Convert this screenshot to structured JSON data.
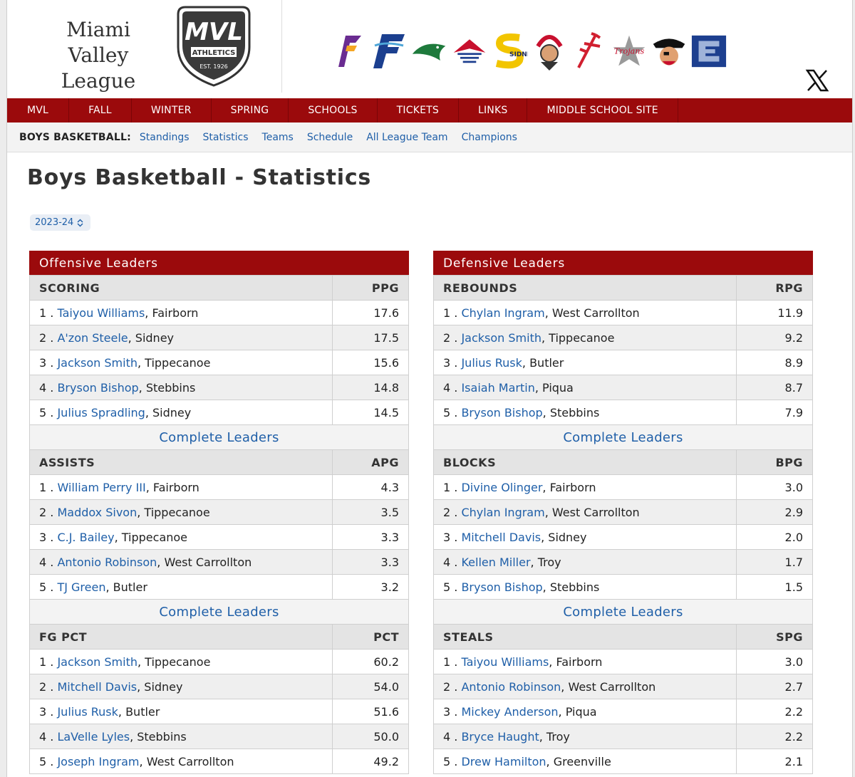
{
  "brand": {
    "line1": "Miami Valley",
    "line2": "League",
    "shield_text": "MVL",
    "shield_sub": "ATHLETICS",
    "shield_est": "EST. 1926"
  },
  "logos": [
    "fairborn-icon",
    "f-logo-icon",
    "greenville-icon",
    "butler-icon",
    "sidney-icon",
    "piqua-icon",
    "tippecanoe-icon",
    "trojans-icon",
    "pirate-icon",
    "e-logo-icon"
  ],
  "nav": [
    "MVL",
    "FALL",
    "WINTER",
    "SPRING",
    "SCHOOLS",
    "TICKETS",
    "LINKS",
    "MIDDLE SCHOOL SITE"
  ],
  "subnav": {
    "label": "BOYS BASKETBALL:",
    "links": [
      "Standings",
      "Statistics",
      "Teams",
      "Schedule",
      "All League Team",
      "Champions"
    ]
  },
  "page_title": "Boys Basketball - Statistics",
  "season": "2023-24",
  "more_label": "Complete Leaders",
  "offense": {
    "title": "Offensive Leaders",
    "sections": [
      {
        "name": "SCORING",
        "stat": "PPG",
        "rows": [
          {
            "rank": "1 .",
            "player": "Taiyou Williams",
            "team": ", Fairborn",
            "value": "17.6"
          },
          {
            "rank": "2 .",
            "player": "A'zon Steele",
            "team": ", Sidney",
            "value": "17.5"
          },
          {
            "rank": "3 .",
            "player": "Jackson Smith",
            "team": ", Tippecanoe",
            "value": "15.6"
          },
          {
            "rank": "4 .",
            "player": "Bryson Bishop",
            "team": ", Stebbins",
            "value": "14.8"
          },
          {
            "rank": "5 .",
            "player": "Julius Spradling",
            "team": ", Sidney",
            "value": "14.5"
          }
        ]
      },
      {
        "name": "ASSISTS",
        "stat": "APG",
        "rows": [
          {
            "rank": "1 .",
            "player": "William Perry III",
            "team": ", Fairborn",
            "value": "4.3"
          },
          {
            "rank": "2 .",
            "player": "Maddox Sivon",
            "team": ", Tippecanoe",
            "value": "3.5"
          },
          {
            "rank": "3 .",
            "player": "C.J. Bailey",
            "team": ", Tippecanoe",
            "value": "3.3"
          },
          {
            "rank": "4 .",
            "player": "Antonio Robinson",
            "team": ", West Carrollton",
            "value": "3.3"
          },
          {
            "rank": "5 .",
            "player": "TJ Green",
            "team": ", Butler",
            "value": "3.2"
          }
        ]
      },
      {
        "name": "FG PCT",
        "stat": "PCT",
        "rows": [
          {
            "rank": "1 .",
            "player": "Jackson Smith",
            "team": ", Tippecanoe",
            "value": "60.2"
          },
          {
            "rank": "2 .",
            "player": "Mitchell Davis",
            "team": ", Sidney",
            "value": "54.0"
          },
          {
            "rank": "3 .",
            "player": "Julius Rusk",
            "team": ", Butler",
            "value": "51.6"
          },
          {
            "rank": "4 .",
            "player": "LaVelle Lyles",
            "team": ", Stebbins",
            "value": "50.0"
          },
          {
            "rank": "5 .",
            "player": "Joseph Ingram",
            "team": ", West Carrollton",
            "value": "49.2"
          }
        ]
      }
    ]
  },
  "defense": {
    "title": "Defensive Leaders",
    "sections": [
      {
        "name": "REBOUNDS",
        "stat": "RPG",
        "rows": [
          {
            "rank": "1 .",
            "player": "Chylan Ingram",
            "team": ", West Carrollton",
            "value": "11.9"
          },
          {
            "rank": "2 .",
            "player": "Jackson Smith",
            "team": ", Tippecanoe",
            "value": "9.2"
          },
          {
            "rank": "3 .",
            "player": "Julius Rusk",
            "team": ", Butler",
            "value": "8.9"
          },
          {
            "rank": "4 .",
            "player": "Isaiah Martin",
            "team": ", Piqua",
            "value": "8.7"
          },
          {
            "rank": "5 .",
            "player": "Bryson Bishop",
            "team": ", Stebbins",
            "value": "7.9"
          }
        ]
      },
      {
        "name": "BLOCKS",
        "stat": "BPG",
        "rows": [
          {
            "rank": "1 .",
            "player": "Divine Olinger",
            "team": ", Fairborn",
            "value": "3.0"
          },
          {
            "rank": "2 .",
            "player": "Chylan Ingram",
            "team": ", West Carrollton",
            "value": "2.9"
          },
          {
            "rank": "3 .",
            "player": "Mitchell Davis",
            "team": ", Sidney",
            "value": "2.0"
          },
          {
            "rank": "4 .",
            "player": "Kellen Miller",
            "team": ", Troy",
            "value": "1.7"
          },
          {
            "rank": "5 .",
            "player": "Bryson Bishop",
            "team": ", Stebbins",
            "value": "1.5"
          }
        ]
      },
      {
        "name": "STEALS",
        "stat": "SPG",
        "rows": [
          {
            "rank": "1 .",
            "player": "Taiyou Williams",
            "team": ", Fairborn",
            "value": "3.0"
          },
          {
            "rank": "2 .",
            "player": "Antonio Robinson",
            "team": ", West Carrollton",
            "value": "2.7"
          },
          {
            "rank": "3 .",
            "player": "Mickey Anderson",
            "team": ", Piqua",
            "value": "2.2"
          },
          {
            "rank": "4 .",
            "player": "Bryce Haught",
            "team": ", Troy",
            "value": "2.2"
          },
          {
            "rank": "5 .",
            "player": "Drew Hamilton",
            "team": ", Greenville",
            "value": "2.1"
          }
        ]
      }
    ]
  },
  "colors": {
    "brand_red": "#9b0a0c",
    "link_blue": "#1f5fa8"
  }
}
